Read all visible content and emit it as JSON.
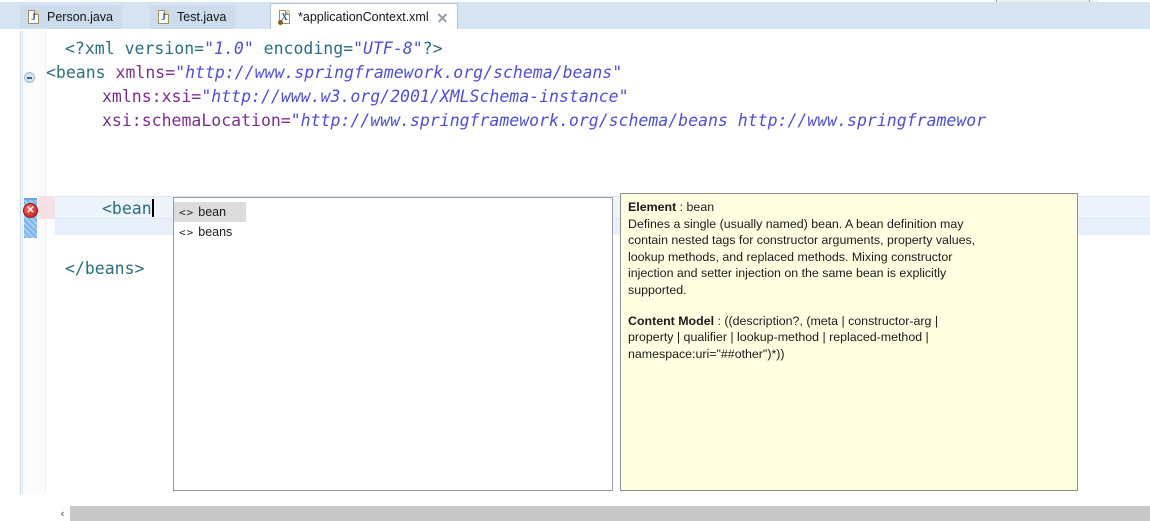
{
  "window": {
    "app": "Eclipse IDE",
    "editor_type": "xml-editor"
  },
  "tabs": [
    {
      "label": "Person.java",
      "icon": "java-file-icon",
      "icon_glyph": "J",
      "active": false,
      "dirty": false,
      "closable": false
    },
    {
      "label": "Test.java",
      "icon": "java-file-icon",
      "icon_glyph": "J",
      "active": false,
      "dirty": false,
      "closable": false
    },
    {
      "label": "*applicationContext.xml",
      "icon": "xml-file-icon",
      "icon_glyph": "X",
      "active": true,
      "dirty": true,
      "closable": true
    }
  ],
  "editor": {
    "gutter": {
      "error_marker_tooltip": "error-marker",
      "fold_marker": "collapse-fold-marker"
    },
    "lines": [
      {
        "indent": 1,
        "tokens": [
          {
            "text": "<?xml version=",
            "class": "t-pi"
          },
          {
            "text": "\"1.0\"",
            "class": "t-str"
          },
          {
            "text": " encoding=",
            "class": "t-pi"
          },
          {
            "text": "\"UTF-8\"",
            "class": "t-str"
          },
          {
            "text": "?>",
            "class": "t-pi"
          }
        ]
      },
      {
        "indent": 0,
        "tokens": [
          {
            "text": "<beans",
            "class": "t-tag"
          },
          {
            "text": " xmlns=",
            "class": "t-attr"
          },
          {
            "text": "\"http://www.springframework.org/schema/beans\"",
            "class": "t-str"
          }
        ]
      },
      {
        "indent": 2,
        "tokens": [
          {
            "text": "xmlns:xsi=",
            "class": "t-attr"
          },
          {
            "text": "\"http://www.w3.org/2001/XMLSchema-instance\"",
            "class": "t-str"
          }
        ]
      },
      {
        "indent": 2,
        "tokens": [
          {
            "text": "xsi:schemaLocation=",
            "class": "t-attr"
          },
          {
            "text": "\"http://www.springframework.org/schema/beans http://www.springframewor",
            "class": "t-str"
          }
        ]
      }
    ],
    "active_line": {
      "indent": 2,
      "text": "<bean",
      "has_caret": true
    },
    "closing_line": {
      "indent": 1,
      "text": "</beans>"
    },
    "cursor_icon": "text-ibeam-cursor"
  },
  "autocomplete": {
    "items": [
      {
        "label": "bean",
        "icon": "xml-element-icon",
        "icon_glyph": "<>",
        "selected": true
      },
      {
        "label": "beans",
        "icon": "xml-element-icon",
        "icon_glyph": "<>",
        "selected": false
      }
    ]
  },
  "documentation": {
    "element_label": "Element",
    "element_sep": " : ",
    "element_name": "bean",
    "description_lines": [
      "Defines a single (usually named) bean. A bean definition may",
      "contain nested tags for constructor arguments, property values,",
      "lookup methods, and replaced methods. Mixing constructor",
      "injection and setter injection on the same bean is explicitly",
      "supported."
    ],
    "content_model_label": "Content Model",
    "content_model_sep": " : ",
    "content_model_lines": [
      "((description?, (meta | constructor-arg |",
      "property | qualifier | lookup-method | replaced-method |",
      "namespace:uri=\"##other\")*))"
    ]
  },
  "scrollbar": {
    "left_arrow_glyph": "‹",
    "name": "horizontal-scrollbar"
  },
  "colors": {
    "tab_bar_bg": "#d6e3f0",
    "tab_inactive_bg": "#cddcec",
    "tab_active_bg": "#ffffff",
    "editor_bg": "#ffffff",
    "tag_color": "#2b6e7e",
    "attr_color": "#7a2f8f",
    "string_color": "#4f4fd0",
    "tooltip_bg": "#ffffe1",
    "error_red": "#d8302a",
    "current_line_bg": "#eef4fb",
    "scrollbar_track": "#c8c8c8"
  }
}
